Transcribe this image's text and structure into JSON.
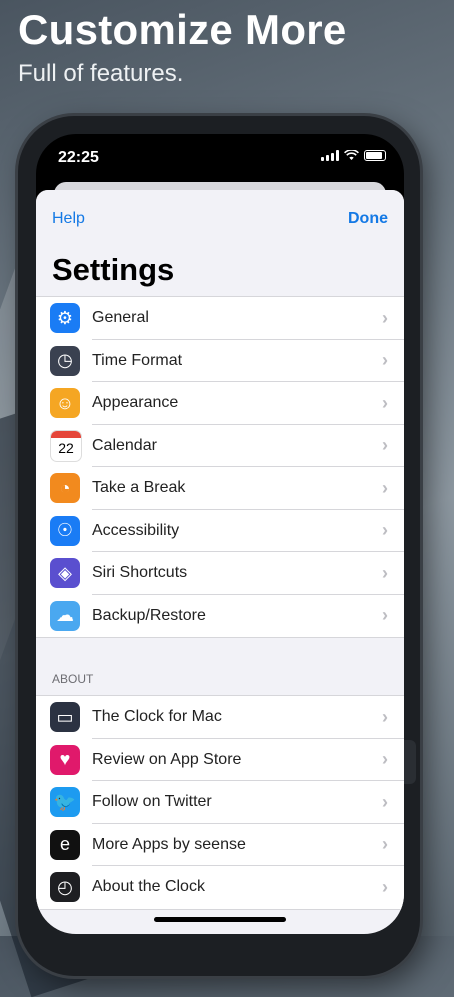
{
  "headline": "Customize More",
  "subline": "Full of features.",
  "status": {
    "time": "22:25"
  },
  "nav": {
    "left": "Help",
    "right": "Done"
  },
  "title": "Settings",
  "settings": [
    {
      "label": "General",
      "icon": "gear-icon",
      "color": "#1a7cf5",
      "glyph": "⚙"
    },
    {
      "label": "Time Format",
      "icon": "clock-icon",
      "color": "#3a4150",
      "glyph": "◷"
    },
    {
      "label": "Appearance",
      "icon": "theater-masks-icon",
      "color": "#f5a623",
      "glyph": "☺"
    },
    {
      "label": "Calendar",
      "icon": "calendar-icon",
      "color": "#ffffff",
      "glyph": "22"
    },
    {
      "label": "Take a Break",
      "icon": "pie-timer-icon",
      "color": "#f28a1e",
      "glyph": "◔"
    },
    {
      "label": "Accessibility",
      "icon": "accessibility-icon",
      "color": "#1a7cf5",
      "glyph": "☉"
    },
    {
      "label": "Siri Shortcuts",
      "icon": "shortcuts-icon",
      "color": "#5a4fcf",
      "glyph": "◈"
    },
    {
      "label": "Backup/Restore",
      "icon": "cloud-icon",
      "color": "#4aa8f0",
      "glyph": "☁"
    }
  ],
  "about_header": "ABOUT",
  "about": [
    {
      "label": "The Clock for Mac",
      "icon": "monitor-icon",
      "color": "#2b3242",
      "glyph": "▭"
    },
    {
      "label": "Review on App Store",
      "icon": "heart-icon",
      "color": "#e0196b",
      "glyph": "♥"
    },
    {
      "label": "Follow on Twitter",
      "icon": "twitter-icon",
      "color": "#1d9bf0",
      "glyph": "🐦"
    },
    {
      "label": "More Apps by seense",
      "icon": "seense-logo-icon",
      "color": "#111111",
      "glyph": "e"
    },
    {
      "label": "About the Clock",
      "icon": "clock-app-icon",
      "color": "#1e1f22",
      "glyph": "◴"
    }
  ],
  "chevron": "›"
}
